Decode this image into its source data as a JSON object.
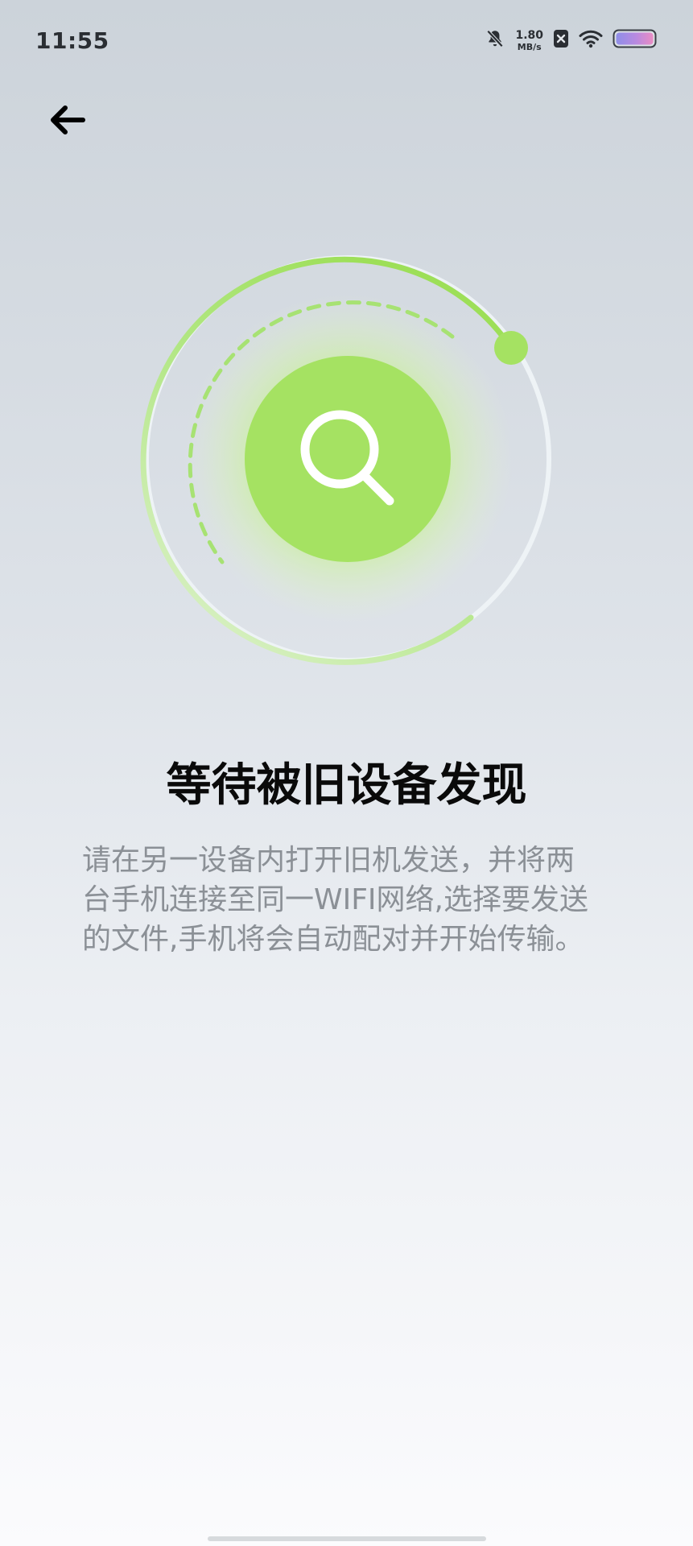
{
  "status_bar": {
    "time": "11:55",
    "net_speed_value": "1.80",
    "net_speed_unit": "MB/s",
    "icons": [
      "bell-muted-icon",
      "sim-x-icon",
      "wifi-icon",
      "battery-icon"
    ]
  },
  "header": {
    "back_icon": "arrow-left-icon"
  },
  "radar": {
    "center_icon": "search-icon",
    "accent_color": "#a5e262",
    "glow_color": "#c9f09a"
  },
  "main": {
    "title": "等待被旧设备发现",
    "description": "请在另一设备内打开旧机发送，并将两台手机连接至同一WIFI网络,选择要发送的文件,手机将会自动配对并开始传输。"
  },
  "colors": {
    "title": "#0a0a0a",
    "description": "#8b9096",
    "background_top": "#ccd3da",
    "background_bottom": "#fbfbfd"
  }
}
